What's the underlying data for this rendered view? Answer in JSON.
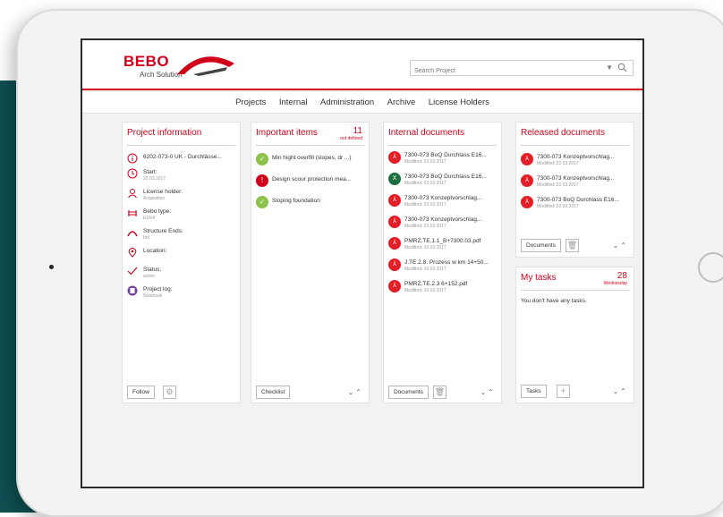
{
  "brand": {
    "name": "BEBO",
    "tagline": "Arch Solution"
  },
  "search": {
    "placeholder": "Search Project"
  },
  "nav": {
    "items": [
      "Projects",
      "Internal",
      "Administration",
      "Archive",
      "License Holders"
    ]
  },
  "project_info": {
    "title": "Project information",
    "rows": [
      {
        "icon": "info-icon",
        "label": "6202-073-0 UK - Durchlässe...",
        "meta": ""
      },
      {
        "icon": "clock-icon",
        "label": "Start:",
        "meta": "22.03.2017"
      },
      {
        "icon": "person-icon",
        "label": "License holder:",
        "meta": "Acquisition"
      },
      {
        "icon": "structure-icon",
        "label": "Bebo type:",
        "meta": "E16/4"
      },
      {
        "icon": "arch-icon",
        "label": "Structure Ends:",
        "meta": "Ibd"
      },
      {
        "icon": "location-icon",
        "label": "Location:",
        "meta": ""
      },
      {
        "icon": "check-icon",
        "label": "Status:",
        "meta": "active"
      },
      {
        "icon": "notebook-icon",
        "label": "Project log:",
        "meta": "Notebook"
      }
    ],
    "follow_label": "Follow"
  },
  "important_items": {
    "title": "Important items",
    "count": "11",
    "count_sub": "not defined",
    "items": [
      {
        "status": "ok",
        "label": "Min hight overfill (slopes, dr ...)"
      },
      {
        "status": "warning",
        "label": "Design scour protection mea..."
      },
      {
        "status": "ok",
        "label": "Sloping foundation"
      }
    ],
    "checklist_label": "Checklist"
  },
  "internal_documents": {
    "title": "Internal documents",
    "docs": [
      {
        "type": "pdf",
        "name": "7300-073 BoQ Durchlass E16...",
        "modified": "Modified: 22.03.2017"
      },
      {
        "type": "xls",
        "name": "7300-073 BoQ Durchlass E16...",
        "modified": "Modified: 22.03.2017"
      },
      {
        "type": "pdf",
        "name": "7300-073 Konzeptvorschlag...",
        "modified": "Modified: 22.03.2017"
      },
      {
        "type": "pdf",
        "name": "7300-073 Konzeptvorschlag...",
        "modified": "Modified: 22.03.2017"
      },
      {
        "type": "pdf",
        "name": "PMRZ.TE.1.1_B+7300.03.pdf",
        "modified": "Modified: 16.03.2017"
      },
      {
        "type": "pdf",
        "name": "J.TE.2.8. Prozess w km 14+50...",
        "modified": "Modified: 16.03.2017"
      },
      {
        "type": "pdf",
        "name": "PMRZ.TE.2.3 6+152.pdf",
        "modified": "Modified: 16.03.2017"
      }
    ],
    "documents_label": "Documents"
  },
  "released_documents": {
    "title": "Released documents",
    "docs": [
      {
        "type": "pdf",
        "name": "7300-073 Konzeptvorschlag...",
        "modified": "Modified: 22.03.2017"
      },
      {
        "type": "pdf",
        "name": "7300-073 Konzeptvorschlag...",
        "modified": "Modified: 22.03.2017"
      },
      {
        "type": "pdf",
        "name": "7300-073 BoQ Durchlass E16...",
        "modified": "Modified: 22.03.2017"
      }
    ],
    "documents_label": "Documents"
  },
  "my_tasks": {
    "title": "My tasks",
    "count": "28",
    "count_sub": "Wednesday",
    "empty_message": "You don't have any tasks.",
    "tasks_label": "Tasks"
  },
  "colors": {
    "accent": "#d0021b",
    "ok": "#8bc34a",
    "excel": "#1d6f42"
  }
}
